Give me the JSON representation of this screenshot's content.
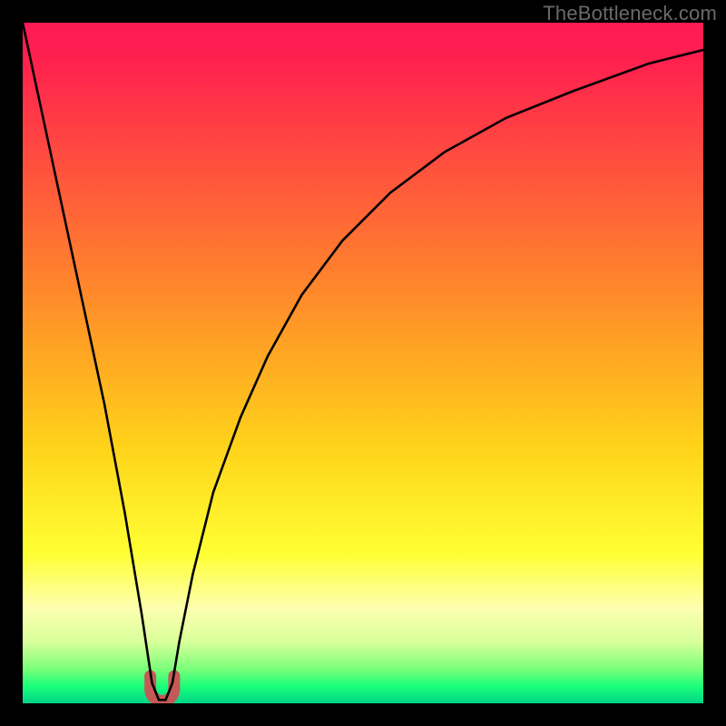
{
  "watermark": "TheBottleneck.com",
  "chart_data": {
    "type": "line",
    "title": "",
    "xlabel": "",
    "ylabel": "",
    "xlim": [
      0,
      100
    ],
    "ylim": [
      0,
      100
    ],
    "grid": false,
    "series": [
      {
        "name": "bottleneck-curve",
        "x": [
          0,
          3,
          6,
          9,
          12,
          15,
          17.5,
          19,
          20,
          21,
          22,
          23,
          25,
          28,
          32,
          36,
          41,
          47,
          54,
          62,
          71,
          81,
          92,
          100
        ],
        "y": [
          100,
          86,
          72,
          58,
          44,
          28,
          13,
          3,
          0.5,
          0.5,
          3,
          9,
          19,
          31,
          42,
          51,
          60,
          68,
          75,
          81,
          86,
          90,
          94,
          96
        ]
      }
    ],
    "marker": {
      "name": "optimal-point",
      "x_center": 20.5,
      "width": 3.5,
      "height": 4,
      "color": "#c45a57"
    },
    "gradient_stops": [
      {
        "offset": 0.0,
        "color": "#ff1a55"
      },
      {
        "offset": 0.05,
        "color": "#ff1f4f"
      },
      {
        "offset": 0.4,
        "color": "#ff8a2a"
      },
      {
        "offset": 0.62,
        "color": "#ffd21a"
      },
      {
        "offset": 0.78,
        "color": "#ffff33"
      },
      {
        "offset": 0.86,
        "color": "#fdffb0"
      },
      {
        "offset": 0.91,
        "color": "#d8ff9a"
      },
      {
        "offset": 0.95,
        "color": "#79ff79"
      },
      {
        "offset": 0.975,
        "color": "#1aff7a"
      },
      {
        "offset": 1.0,
        "color": "#00d487"
      }
    ]
  }
}
